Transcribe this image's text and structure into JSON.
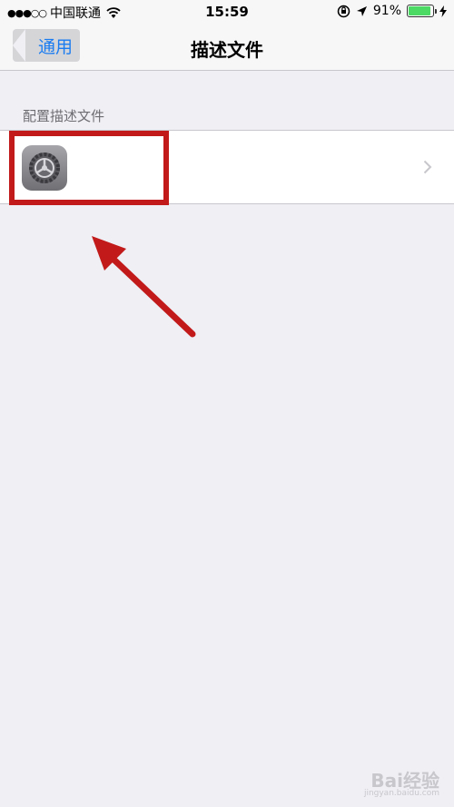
{
  "status_bar": {
    "signal": "●●●○○",
    "carrier": "中国联通",
    "time": "15:59",
    "battery_percent": "91%",
    "battery_level": 0.91
  },
  "nav_bar": {
    "back_label": "通用",
    "title": "描述文件"
  },
  "section": {
    "header": "配置描述文件",
    "row_icon": "settings-gear-icon"
  },
  "watermark": {
    "brand": "Bai经验",
    "url": "jingyan.baidu.com"
  },
  "colors": {
    "accent": "#1a7cf0",
    "annotation": "#c21a1a",
    "battery": "#4cd964",
    "background": "#efeff4"
  }
}
